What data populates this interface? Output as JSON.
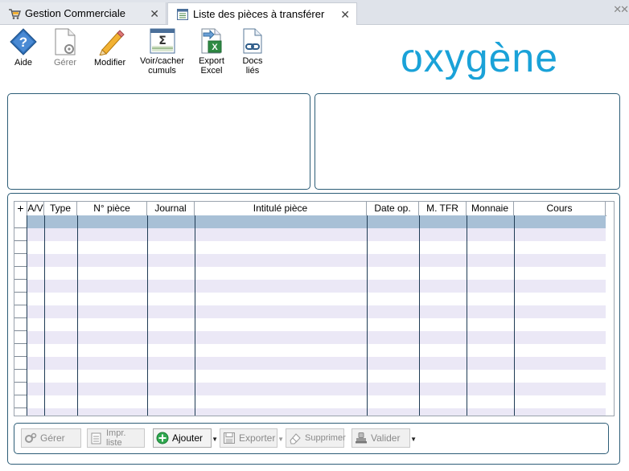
{
  "tabs": [
    {
      "label": "Gestion Commerciale",
      "icon": "shopping-cart-icon",
      "active": false
    },
    {
      "label": "Liste des pièces à transférer",
      "icon": "document-list-icon",
      "active": true
    }
  ],
  "tab_close_symbol": "✕",
  "window_close_symbol": "✕✕",
  "toolbar": {
    "aide": "Aide",
    "gerer": "Gérer",
    "modifier": "Modifier",
    "voir_cacher_l1": "Voir/cacher",
    "voir_cacher_l2": "cumuls",
    "export_l1": "Export",
    "export_l2": "Excel",
    "docs_l1": "Docs",
    "docs_l2": "liés"
  },
  "logo": {
    "text": "oxygène",
    "color": "#1aa2d8"
  },
  "grid": {
    "add_symbol": "+",
    "columns": [
      "A/V",
      "Type",
      "N° pièce",
      "Journal",
      "Intitulé pièce",
      "Date op.",
      "M. TFR",
      "Monnaie",
      "Cours"
    ],
    "rows": []
  },
  "actions": {
    "gerer": "Gérer",
    "impr_liste": "Impr. liste",
    "ajouter": "Ajouter",
    "exporter": "Exporter",
    "supprimer": "Supprimer",
    "valider": "Valider",
    "dropdown_symbol": "▼"
  },
  "colors": {
    "accent": "#2d5d77",
    "selected_row": "#a8c0d6",
    "alt_row": "#ebe8f6",
    "add_button_green": "#2fa84f"
  }
}
